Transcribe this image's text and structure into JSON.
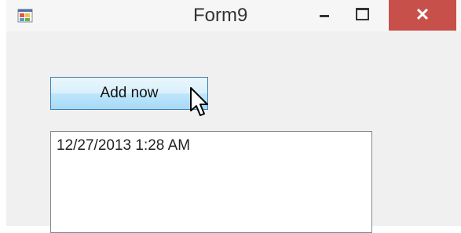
{
  "window": {
    "title": "Form9",
    "app_icon": "winforms-app-icon",
    "controls": {
      "minimize_icon": "minimize-icon",
      "maximize_icon": "maximize-icon",
      "close_symbol": "✕",
      "close_color": "#c7504a"
    }
  },
  "form": {
    "add_button_label": "Add now",
    "listbox_items": [
      "12/27/2013 1:28 AM"
    ]
  },
  "cursor": "mouse-pointer-icon"
}
